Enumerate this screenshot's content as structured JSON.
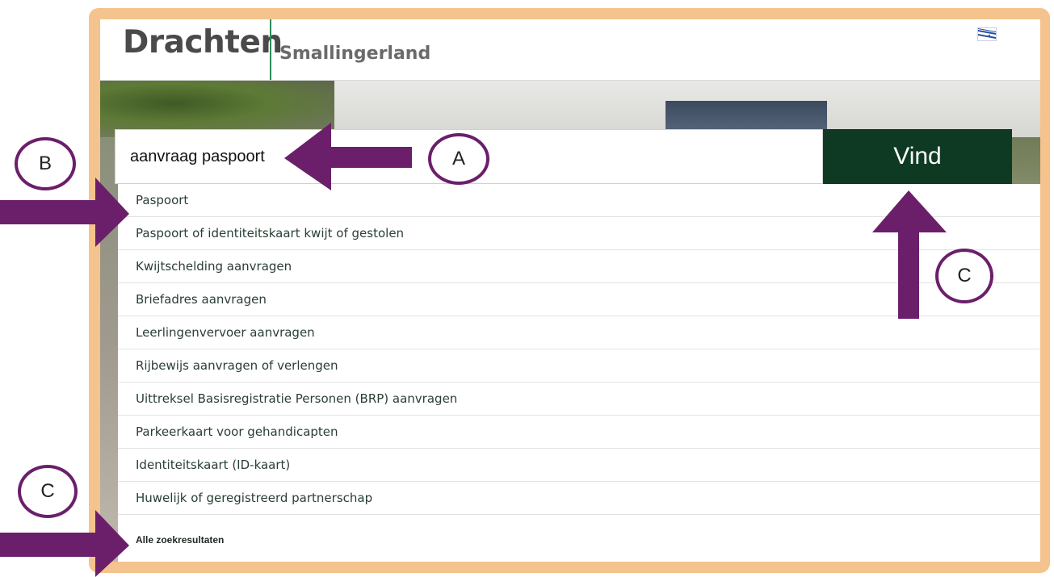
{
  "header": {
    "logo_main": "Drachten",
    "logo_sub": "Smallingerland",
    "flag_icon": "frisian-flag-icon"
  },
  "search": {
    "value": "aanvraag paspoort",
    "button_label": "Vind"
  },
  "results": [
    "Paspoort",
    "Paspoort of identiteitskaart kwijt of gestolen",
    "Kwijtschelding aanvragen",
    "Briefadres aanvragen",
    "Leerlingenvervoer aanvragen",
    "Rijbewijs aanvragen of verlengen",
    "Uittreksel Basisregistratie Personen (BRP) aanvragen",
    "Parkeerkaart voor gehandicapten",
    "Identiteitskaart (ID-kaart)",
    "Huwelijk of geregistreerd partnerschap"
  ],
  "all_results_label": "Alle zoekresultaten",
  "annotations": {
    "a": "A",
    "b": "B",
    "c1": "C",
    "c2": "C",
    "color": "#6b1f6b"
  },
  "colors": {
    "frame": "#f4c38e",
    "button": "#0e3a24",
    "logo_divider": "#2e8b57"
  }
}
